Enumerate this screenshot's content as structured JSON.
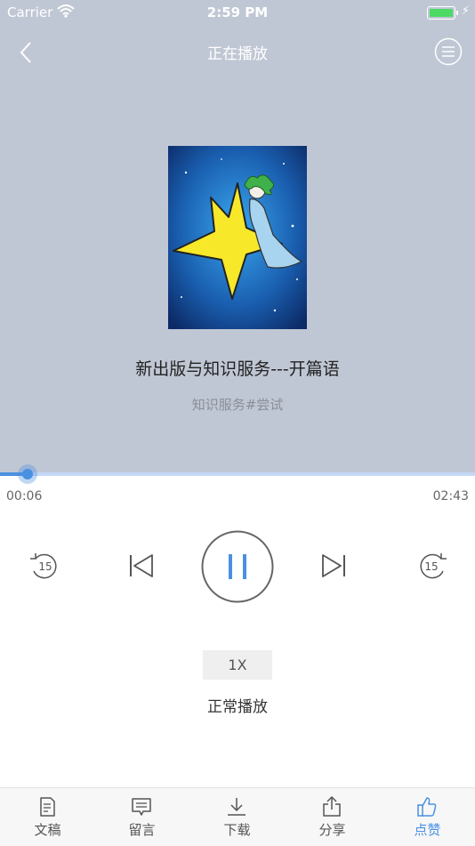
{
  "status_bar": {
    "carrier": "Carrier",
    "time": "2:59 PM",
    "battery_icon": "battery-icon",
    "wifi_icon": "wifi-icon"
  },
  "nav": {
    "title": "正在播放",
    "back_icon": "chevron-left-icon",
    "menu_icon": "list-menu-icon"
  },
  "track": {
    "title": "新出版与知识服务---开篇语",
    "subtitle": "知识服务#尝试",
    "cover_icon": "album-cover-image"
  },
  "progress": {
    "current": "00:06",
    "duration": "02:43",
    "fraction": 0.058
  },
  "controls": {
    "rewind_label": "15",
    "forward_label": "15",
    "state": "playing"
  },
  "speed": {
    "value": "1X",
    "label": "正常播放"
  },
  "tabs": [
    {
      "label": "文稿",
      "icon": "document-icon",
      "active": false
    },
    {
      "label": "留言",
      "icon": "comment-icon",
      "active": false
    },
    {
      "label": "下载",
      "icon": "download-icon",
      "active": false
    },
    {
      "label": "分享",
      "icon": "share-icon",
      "active": false
    },
    {
      "label": "点赞",
      "icon": "thumbs-up-icon",
      "active": true
    }
  ],
  "colors": {
    "header_bg": "#c0c7d4",
    "accent": "#4a90e2",
    "played": "#4a90e2",
    "track": "#c4d8f5"
  }
}
